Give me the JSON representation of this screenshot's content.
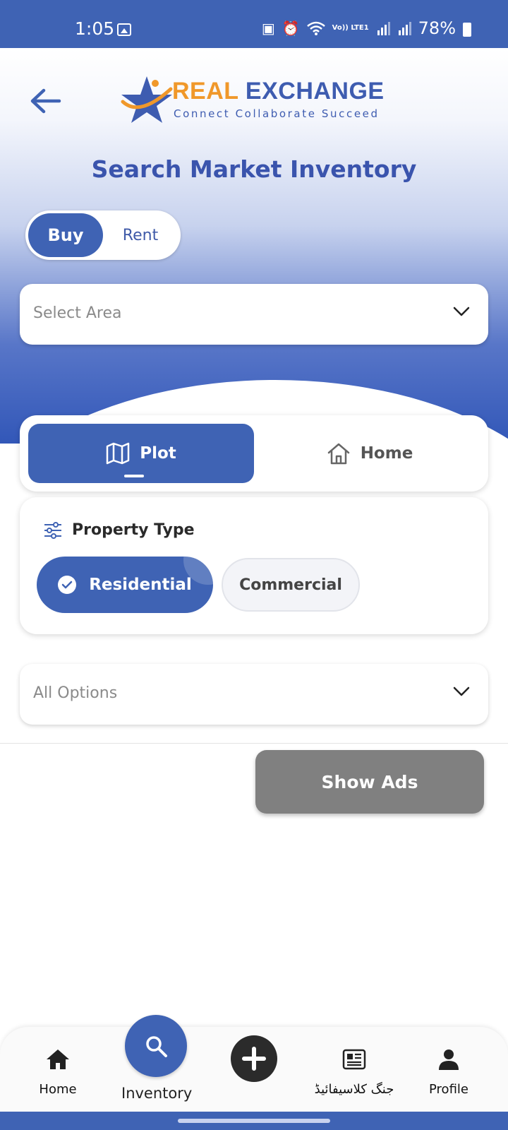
{
  "status_bar": {
    "time": "1:05",
    "lte_label": "Vo)) LTE1",
    "battery": "78%"
  },
  "header": {
    "logo_word1": "REAL",
    "logo_word2": "EXCHANGE",
    "logo_tagline": "Connect Collaborate Succeed",
    "title": "Search Market Inventory"
  },
  "listing_toggle": {
    "options": [
      "Buy",
      "Rent"
    ],
    "selected": "Buy"
  },
  "area_select": {
    "placeholder": "Select Area"
  },
  "category_tabs": {
    "items": [
      "Plot",
      "Home"
    ],
    "selected": "Plot"
  },
  "property_type": {
    "label": "Property Type",
    "options": [
      "Residential",
      "Commercial"
    ],
    "selected": "Residential"
  },
  "options_select": {
    "placeholder": "All Options"
  },
  "show_ads_button": "Show Ads",
  "bottom_nav": {
    "items": [
      "Home",
      "Inventory",
      "",
      "جنگ کلاسیفائیڈ",
      "Profile"
    ],
    "active": "Inventory"
  },
  "colors": {
    "primary": "#3f63b4",
    "accent_orange": "#f0982a",
    "button_disabled": "#808080"
  }
}
